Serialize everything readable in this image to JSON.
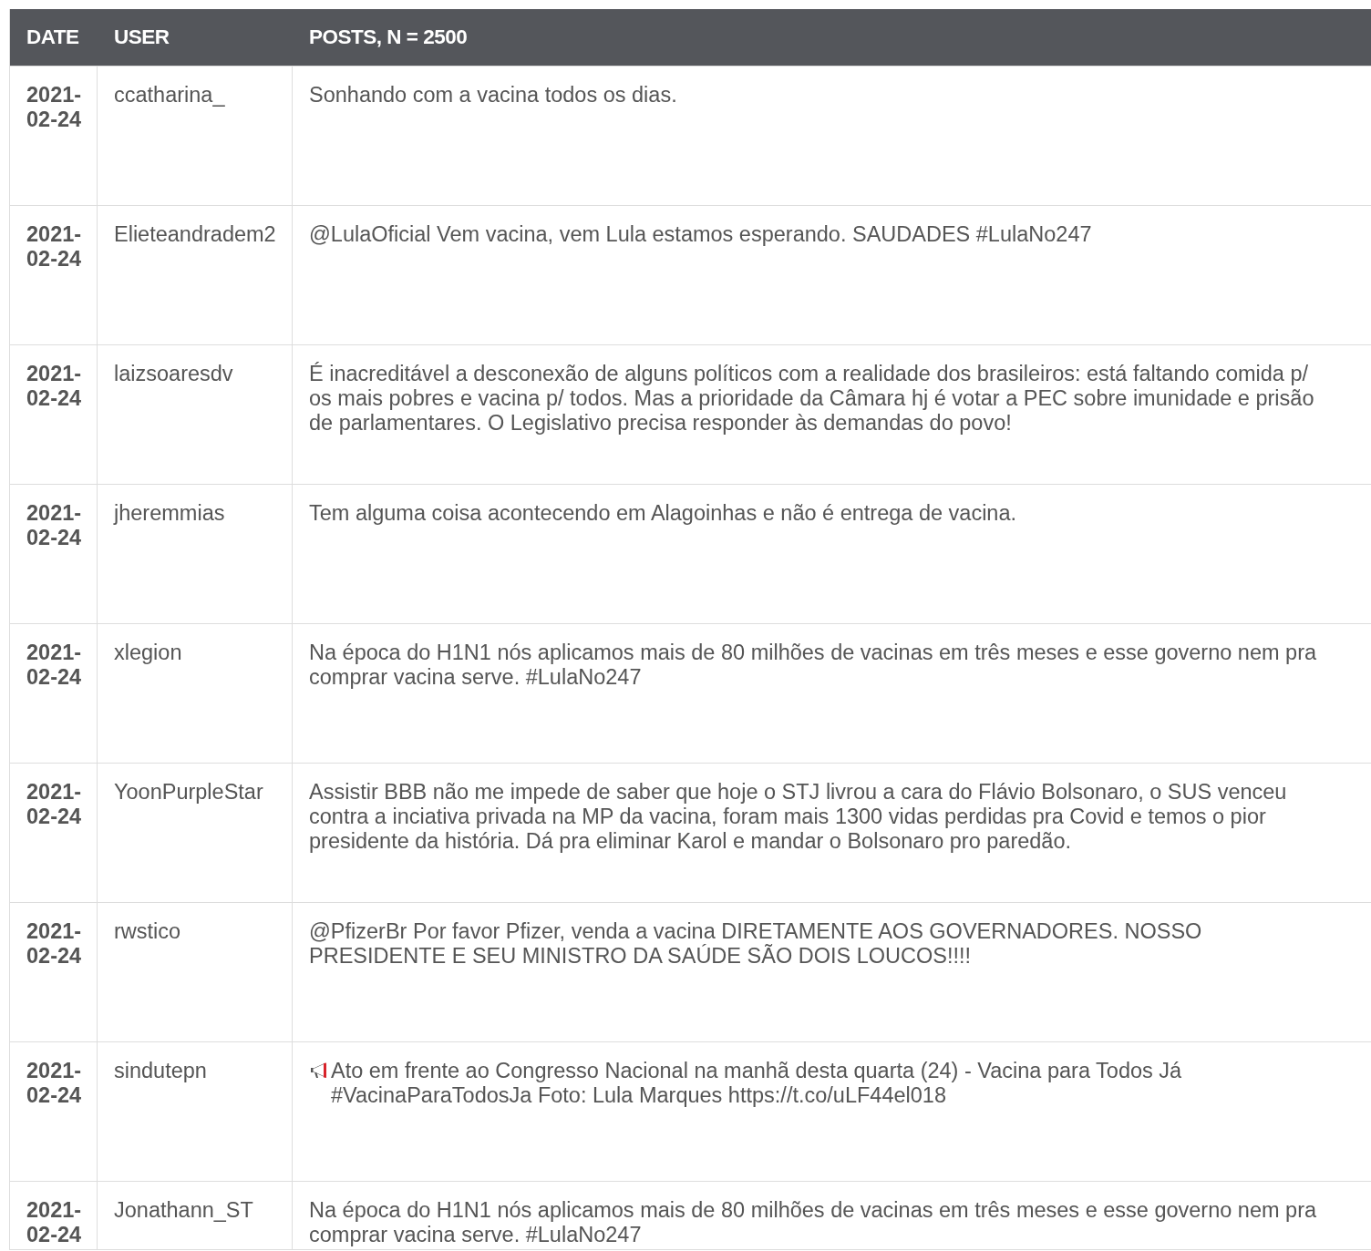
{
  "table": {
    "columns": [
      "DATE",
      "USER",
      "POSTS, N = 2500"
    ],
    "rows": [
      {
        "date": "2021-02-24",
        "user": "ccatharina_",
        "post": "Sonhando com a vacina todos os dias."
      },
      {
        "date": "2021-02-24",
        "user": "Elieteandradem2",
        "post": "@LulaOficial Vem vacina, vem Lula estamos esperando. SAUDADES #LulaNo247"
      },
      {
        "date": "2021-02-24",
        "user": "laizsoaresdv",
        "post": "É inacreditável a desconexão de alguns políticos com a realidade dos brasileiros: está faltando comida p/ os mais pobres e vacina p/ todos. Mas a prioridade da Câmara hj é votar a PEC sobre imunidade e prisão de parlamentares. O Legislativo precisa responder às demandas do povo!"
      },
      {
        "date": "2021-02-24",
        "user": "jheremmias",
        "post": "Tem alguma coisa acontecendo em Alagoinhas e não é entrega de vacina."
      },
      {
        "date": "2021-02-24",
        "user": "xlegion",
        "post": "Na época do H1N1 nós aplicamos mais de 80 milhões de vacinas em três meses e esse governo nem pra comprar vacina serve. #LulaNo247"
      },
      {
        "date": "2021-02-24",
        "user": "YoonPurpleStar",
        "post": "Assistir BBB não me impede de saber que hoje o STJ livrou a cara do Flávio Bolsonaro, o SUS venceu contra a inciativa privada na MP da vacina, foram mais 1300 vidas perdidas pra Covid e temos o pior presidente da história. Dá pra eliminar Karol e mandar o Bolsonaro pro paredão."
      },
      {
        "date": "2021-02-24",
        "user": "rwstico",
        "post": "@PfizerBr Por favor Pfizer, venda a vacina DIRETAMENTE AOS GOVERNADORES. NOSSO PRESIDENTE E SEU MINISTRO DA SAÚDE SÃO DOIS LOUCOS!!!!"
      },
      {
        "date": "2021-02-24",
        "user": "sindutepn",
        "post": "Ato em frente ao Congresso Nacional na manhã desta quarta (24) - Vacina para Todos Já #VacinaParaTodosJa Foto: Lula Marques https://t.co/uLF44el018",
        "kind": "announcement"
      },
      {
        "date": "2021-02-24",
        "user": "Jonathann_ST",
        "post": "Na época do H1N1 nós aplicamos mais de 80 milhões de vacinas em três meses e esse governo nem pra comprar vacina serve. #LulaNo247"
      }
    ]
  }
}
